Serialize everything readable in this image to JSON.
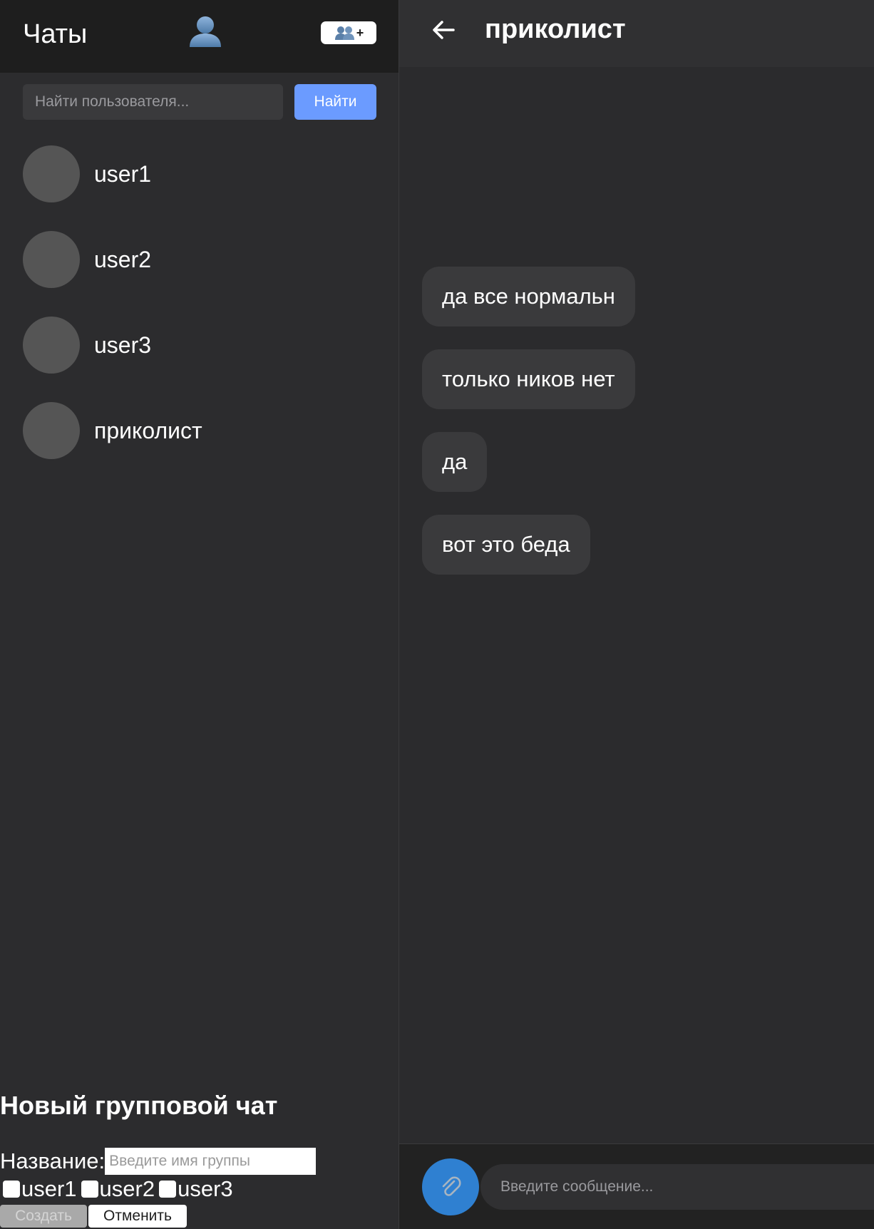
{
  "sidebar": {
    "title": "Чаты",
    "new_group_button_label": "+",
    "search": {
      "placeholder": "Найти пользователя...",
      "button_label": "Найти"
    },
    "contacts": [
      {
        "name": "user1"
      },
      {
        "name": "user2"
      },
      {
        "name": "user3"
      },
      {
        "name": "приколист"
      }
    ],
    "new_group": {
      "title": "Новый групповой чат",
      "name_label": "Название:",
      "name_placeholder": "Введите имя группы",
      "members": [
        "user1",
        "user2",
        "user3"
      ],
      "create_label": "Создать",
      "cancel_label": "Отменить"
    }
  },
  "chat": {
    "title": "приколист",
    "messages": [
      {
        "text": "да все нормальн"
      },
      {
        "text": "только ников нет"
      },
      {
        "text": "да"
      },
      {
        "text": "вот это беда"
      }
    ],
    "composer": {
      "placeholder": "Введите сообщение..."
    }
  },
  "colors": {
    "accent_search": "#6b9bff",
    "accent_attach": "#2f80d1",
    "sidebar_header_bg": "#1e1e1e",
    "panel_bg": "#2c2c2e",
    "bubble_bg": "#3a3a3c"
  },
  "icons": {
    "profile": "user-profile-icon",
    "new_group": "users-group-icon",
    "back": "arrow-left-icon",
    "attach": "paperclip-icon"
  }
}
